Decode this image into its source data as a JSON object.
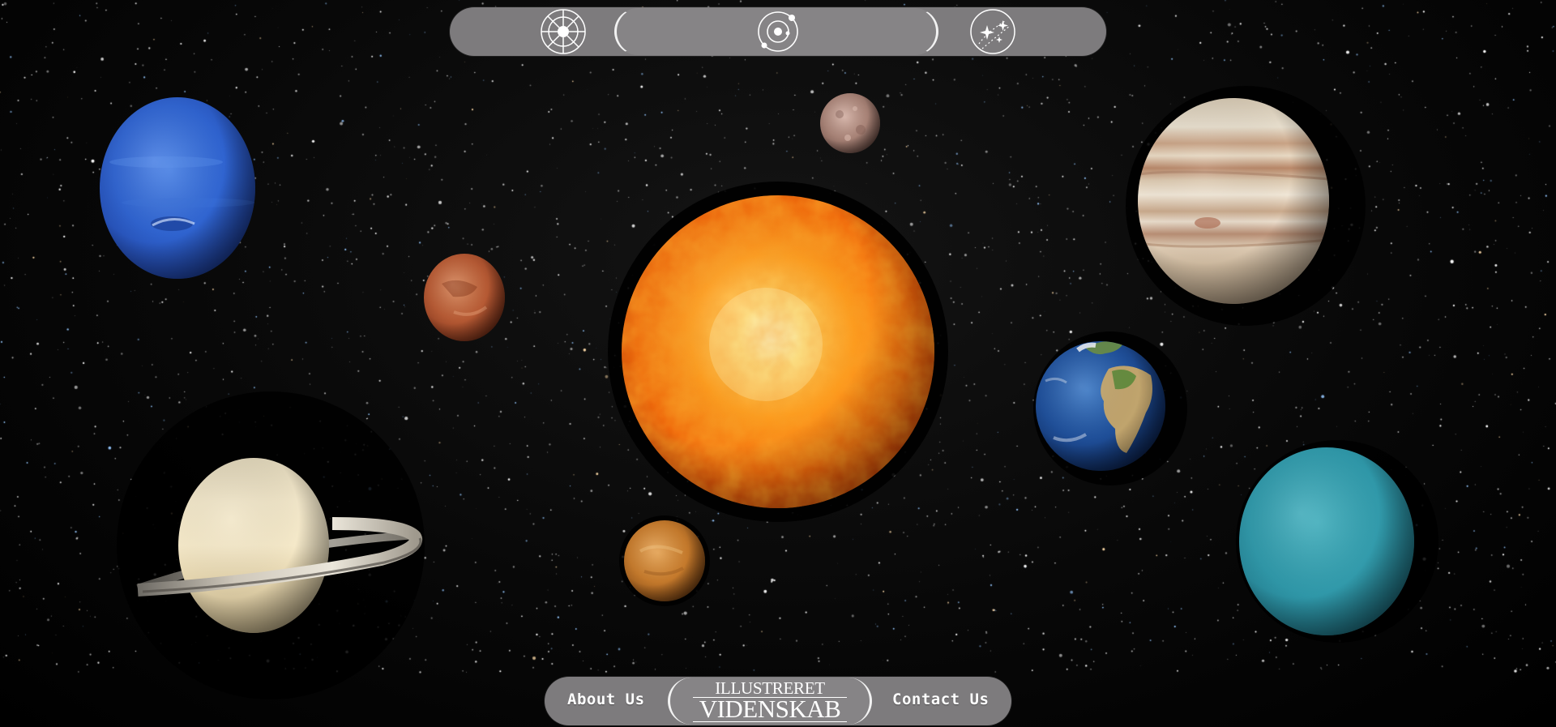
{
  "top_nav": {
    "icons": [
      "sun-dial-icon",
      "solar-system-orbit-icon",
      "galaxy-sparkle-icon"
    ]
  },
  "planets": [
    {
      "name": "Sun",
      "icon": "sun"
    },
    {
      "name": "Mercury",
      "icon": "mercury"
    },
    {
      "name": "Venus",
      "icon": "venus"
    },
    {
      "name": "Earth",
      "icon": "earth"
    },
    {
      "name": "Mars",
      "icon": "mars"
    },
    {
      "name": "Jupiter",
      "icon": "jupiter"
    },
    {
      "name": "Saturn",
      "icon": "saturn"
    },
    {
      "name": "Uranus",
      "icon": "uranus"
    },
    {
      "name": "Neptune",
      "icon": "neptune"
    }
  ],
  "bottom_nav": {
    "about_label": "About Us",
    "contact_label": "Contact Us",
    "logo_top": "ILLUSTRERET",
    "logo_bottom": "VIDENSKAB"
  },
  "colors": {
    "nav_bg": "#7d7b7d",
    "nav_pill": "#868486",
    "nav_text": "#ffffff",
    "space": "#000000"
  }
}
